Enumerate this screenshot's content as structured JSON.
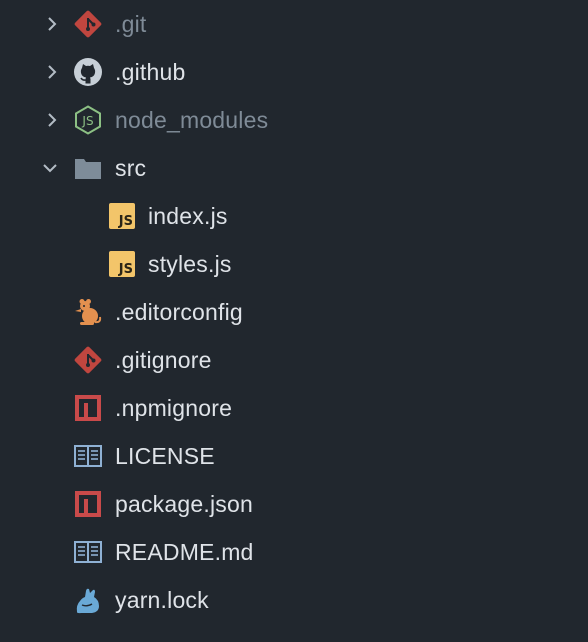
{
  "colors": {
    "background": "#21272e",
    "text": "#dfe3e8",
    "dim_text": "#7f8b97",
    "chevron": "#b3bcc5",
    "git_red": "#c0463f",
    "npm_red": "#c94a4a",
    "js_yellow": "#f3c56a",
    "node_green": "#8cc084",
    "folder_gray": "#7e8c99",
    "license_blue": "#8fb1d4",
    "editorconfig_orange": "#e3904f",
    "yarn_blue": "#6aa9d6"
  },
  "tree": {
    "items": [
      {
        "label": ".git",
        "icon": "git-icon",
        "type": "folder",
        "expanded": false
      },
      {
        "label": ".github",
        "icon": "github-icon",
        "type": "folder",
        "expanded": false
      },
      {
        "label": "node_modules",
        "icon": "nodejs-icon",
        "type": "folder",
        "expanded": false
      },
      {
        "label": "src",
        "icon": "folder-icon",
        "type": "folder",
        "expanded": true
      },
      {
        "label": "index.js",
        "icon": "javascript-file-icon",
        "type": "file"
      },
      {
        "label": "styles.js",
        "icon": "javascript-file-icon",
        "type": "file"
      },
      {
        "label": ".editorconfig",
        "icon": "editorconfig-icon",
        "type": "file"
      },
      {
        "label": ".gitignore",
        "icon": "git-icon",
        "type": "file"
      },
      {
        "label": ".npmignore",
        "icon": "npm-icon",
        "type": "file"
      },
      {
        "label": "LICENSE",
        "icon": "book-icon",
        "type": "file"
      },
      {
        "label": "package.json",
        "icon": "npm-icon",
        "type": "file"
      },
      {
        "label": "README.md",
        "icon": "book-icon",
        "type": "file"
      },
      {
        "label": "yarn.lock",
        "icon": "yarn-icon",
        "type": "file"
      }
    ]
  }
}
